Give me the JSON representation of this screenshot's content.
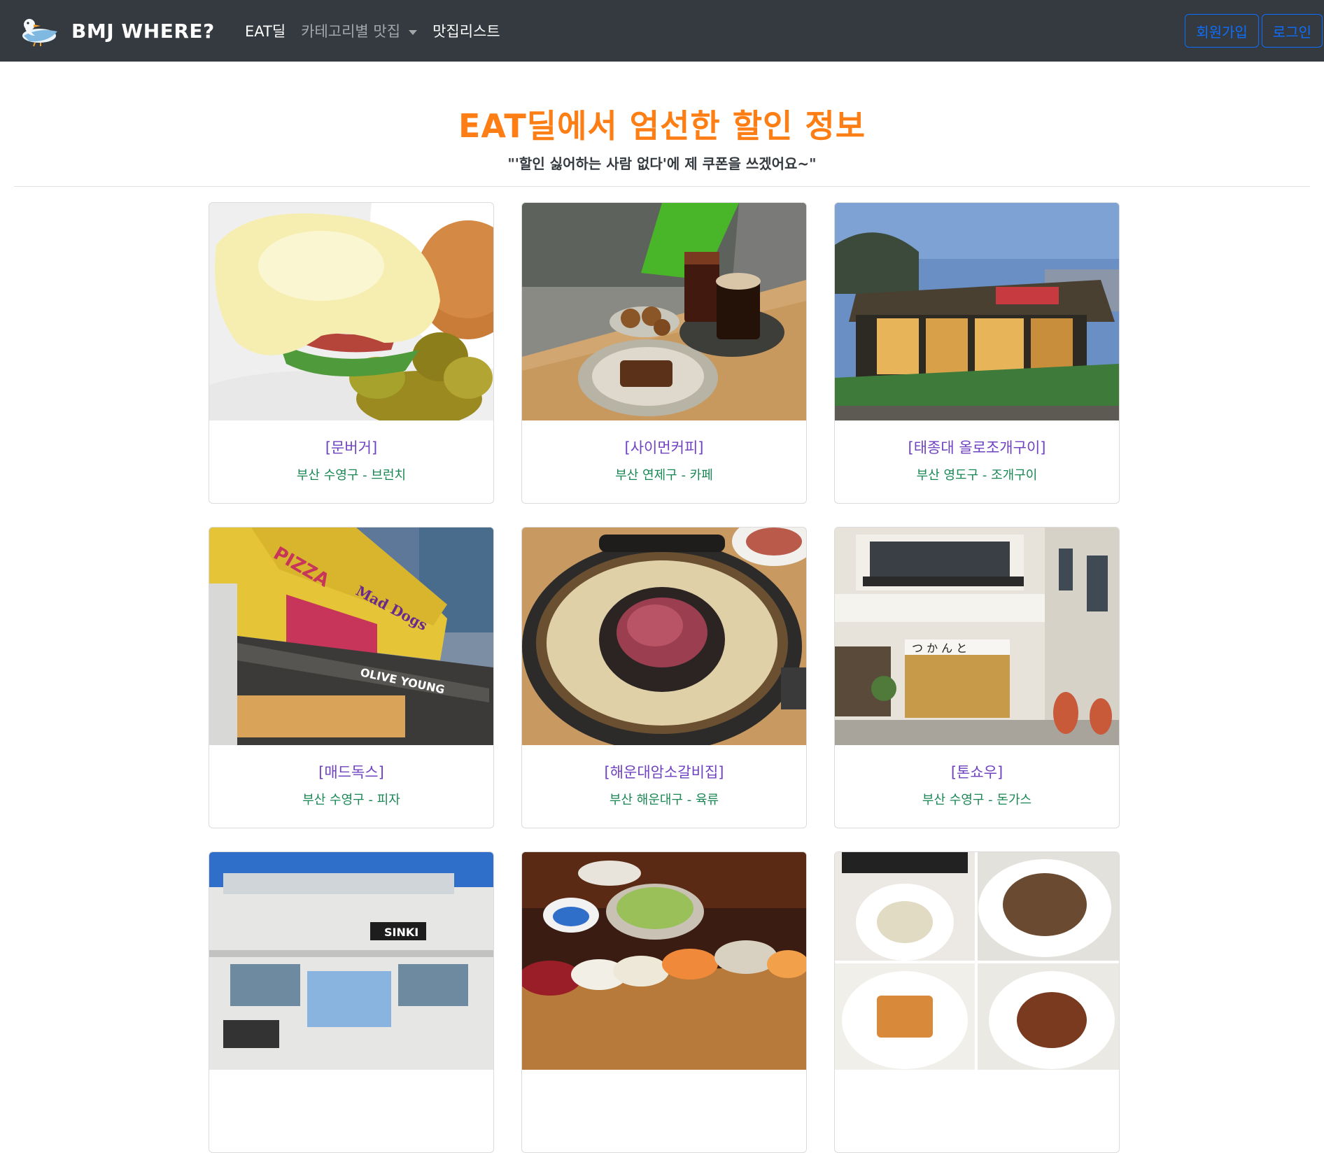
{
  "navbar": {
    "brand": "BMJ WHERE?",
    "links": [
      "EAT딜",
      "카테고리별 맛집",
      "맛집리스트"
    ],
    "signup": "회원가입",
    "login": "로그인"
  },
  "hero": {
    "title": "EAT딜에서 엄선한 할인 정보",
    "subtitle": "\"'할인 싫어하는 사람 없다'에 제 쿠폰을 쓰겠어요~\""
  },
  "cards": [
    {
      "title": "[문버거]",
      "info": "부산 수영구 - 브런치"
    },
    {
      "title": "[사이먼커피]",
      "info": "부산 연제구 - 카페"
    },
    {
      "title": "[태종대 올로조개구이]",
      "info": "부산 영도구 - 조개구이"
    },
    {
      "title": "[매드독스]",
      "info": "부산 수영구 - 피자"
    },
    {
      "title": "[해운대암소갈비집]",
      "info": "부산 해운대구 - 육류"
    },
    {
      "title": "[톤쇼우]",
      "info": "부산 수영구 - 돈가스"
    },
    {
      "title": "",
      "info": ""
    },
    {
      "title": "",
      "info": ""
    },
    {
      "title": "",
      "info": ""
    }
  ],
  "photo_text": {
    "pizza_sign": "PIZZA",
    "madogs_sign": "Mad Dogs",
    "store_sign": "OLIVE YOUNG",
    "building_sign": "SINKI",
    "tonshou_sign": "つ か ん と"
  },
  "colors": {
    "navbar": "#343a40",
    "accent": "#fd7e14",
    "title": "#6f42c1",
    "info": "#198754",
    "button": "#0d6efd"
  }
}
